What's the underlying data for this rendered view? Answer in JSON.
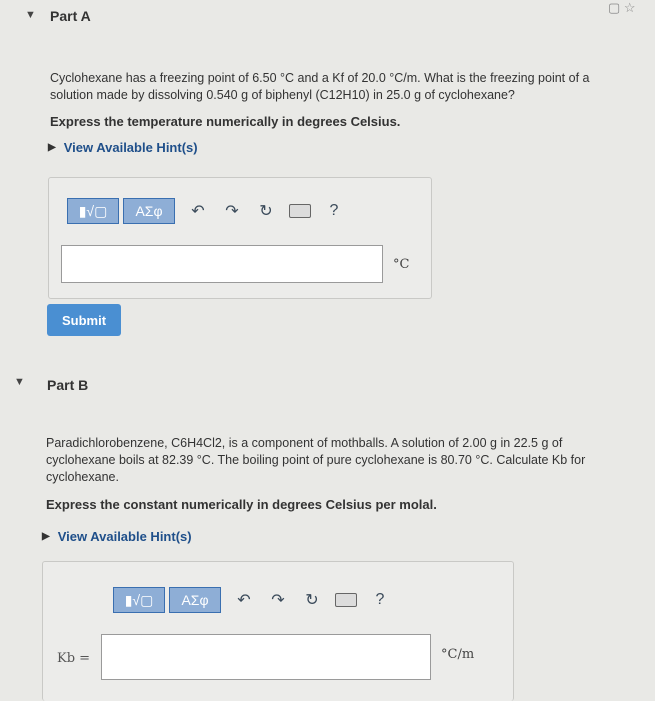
{
  "partA": {
    "header": "Part A",
    "question_line1": "Cyclohexane has a freezing point of 6.50 °C and a Kf of 20.0 °C/m. What is the freezing point of a",
    "question_line2": "solution made by dissolving 0.540 g of biphenyl (C12H10) in 25.0 g of cyclohexane?",
    "instruction": "Express the temperature numerically in degrees Celsius.",
    "hint": "View Available Hint(s)",
    "toolbar": {
      "templates_label": "▮√▢",
      "greek_label": "ΑΣφ",
      "undo_icon": "↶",
      "redo_icon": "↷",
      "reset_icon": "↻",
      "keyboard_icon": "keyboard-icon",
      "help_label": "?"
    },
    "answer_value": "",
    "unit": "°C",
    "submit_label": "Submit"
  },
  "partB": {
    "header": "Part B",
    "question_line1": "Paradichlorobenzene, C6H4Cl2, is a component of mothballs. A solution of 2.00 g in 22.5 g of",
    "question_line2": "cyclohexane boils at 82.39 °C. The boiling point of pure cyclohexane is 80.70 °C. Calculate Kb for",
    "question_line3": "cyclohexane.",
    "instruction": "Express the constant numerically in degrees Celsius per molal.",
    "hint": "View Available Hint(s)",
    "toolbar": {
      "templates_label": "▮√▢",
      "greek_label": "ΑΣφ",
      "undo_icon": "↶",
      "redo_icon": "↷",
      "reset_icon": "↻",
      "keyboard_icon": "keyboard-icon",
      "help_label": "?"
    },
    "answer_label": "Kb =",
    "answer_value": "",
    "unit": "°C/m"
  },
  "colors": {
    "background": "#e9e9e6",
    "accent": "#4a8fd2",
    "hint_link": "#1f4f8a"
  }
}
